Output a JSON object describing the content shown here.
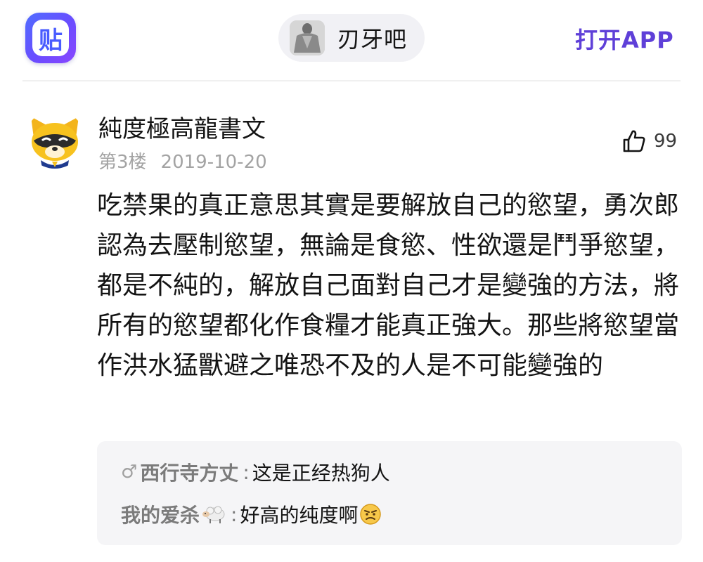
{
  "header": {
    "app_logo_glyph": "贴",
    "forum_name": "刃牙吧",
    "open_app": "打开APP"
  },
  "post": {
    "username": "純度極高龍書文",
    "floor": "第3楼",
    "date": "2019-10-20",
    "like_count": "99",
    "content": "吃禁果的真正意思其實是要解放自己的慾望，勇次郎認為去壓制慾望，無論是食慾、性欲還是鬥爭慾望，都是不純的，解放自己面對自己才是變強的方法，將所有的慾望都化作食糧才能真正強大。那些將慾望當作洪水猛獸避之唯恐不及的人是不可能變強的"
  },
  "replies": [
    {
      "gender_icon": "♂",
      "author": "西行寺方丈",
      "separator": ":",
      "text": "这是正经热狗人"
    },
    {
      "author": "我的爱杀",
      "author_emoji": "sheep-emoji",
      "separator": ":",
      "text": "好高的纯度啊",
      "text_emoji": "angry-face-emoji"
    }
  ],
  "colors": {
    "accent": "#5f40d8",
    "logo_blue": "#4a5cff",
    "meta_gray": "#a3a3a3",
    "reply_bg": "#f5f5f7"
  }
}
